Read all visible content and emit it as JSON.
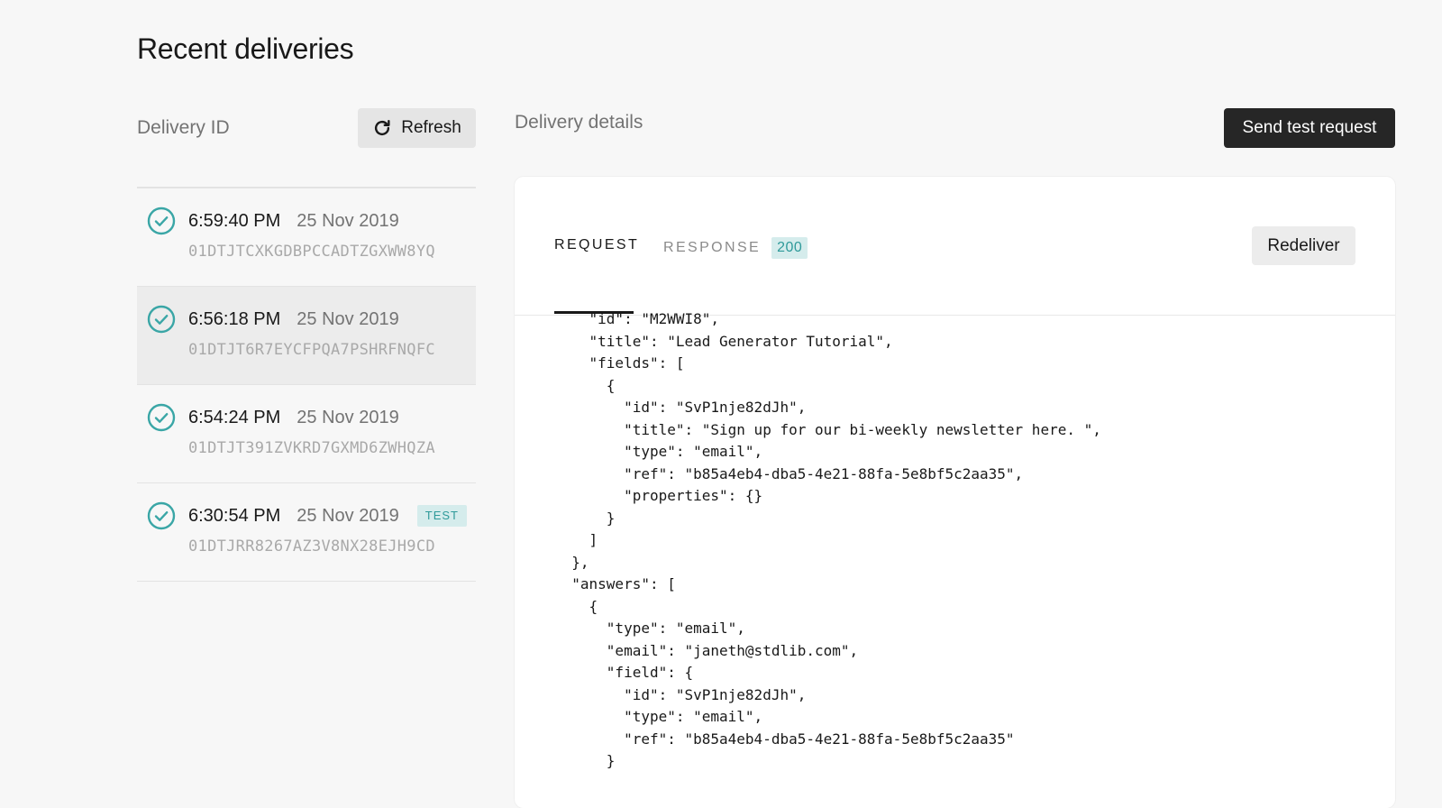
{
  "page": {
    "title": "Recent deliveries"
  },
  "left": {
    "column_label": "Delivery ID",
    "refresh_label": "Refresh",
    "refresh_icon": "refresh-icon"
  },
  "deliveries": [
    {
      "time": "6:59:40 PM",
      "date": "25 Nov 2019",
      "id": "01DTJTCXKGDBPCCADTZGXWW8YQ",
      "status_icon": "check-circle-icon",
      "badge": "",
      "selected": false
    },
    {
      "time": "6:56:18 PM",
      "date": "25 Nov 2019",
      "id": "01DTJT6R7EYCFPQA7PSHRFNQFC",
      "status_icon": "check-circle-icon",
      "badge": "",
      "selected": true
    },
    {
      "time": "6:54:24 PM",
      "date": "25 Nov 2019",
      "id": "01DTJT391ZVKRD7GXMD6ZWHQZA",
      "status_icon": "check-circle-icon",
      "badge": "",
      "selected": false
    },
    {
      "time": "6:30:54 PM",
      "date": "25 Nov 2019",
      "id": "01DTJRR8267AZ3V8NX28EJH9CD",
      "status_icon": "check-circle-icon",
      "badge": "TEST",
      "selected": false
    }
  ],
  "details": {
    "label": "Delivery details",
    "send_test_label": "Send test request",
    "tabs": {
      "request": "REQUEST",
      "response": "RESPONSE",
      "response_status": "200",
      "active": "request"
    },
    "redeliver_label": "Redeliver",
    "code": "    \"id\": \"M2WWI8\",\n    \"title\": \"Lead Generator Tutorial\",\n    \"fields\": [\n      {\n        \"id\": \"SvP1nje82dJh\",\n        \"title\": \"Sign up for our bi-weekly newsletter here. \",\n        \"type\": \"email\",\n        \"ref\": \"b85a4eb4-dba5-4e21-88fa-5e8bf5c2aa35\",\n        \"properties\": {}\n      }\n    ]\n  },\n  \"answers\": [\n    {\n      \"type\": \"email\",\n      \"email\": \"janeth@stdlib.com\",\n      \"field\": {\n        \"id\": \"SvP1nje82dJh\",\n        \"type\": \"email\",\n        \"ref\": \"b85a4eb4-dba5-4e21-88fa-5e8bf5c2aa35\"\n      }"
  },
  "colors": {
    "accent": "#3aa6a6",
    "badge_bg": "#d5ecec",
    "dark_button": "#262626",
    "background": "#f7f7f7"
  }
}
